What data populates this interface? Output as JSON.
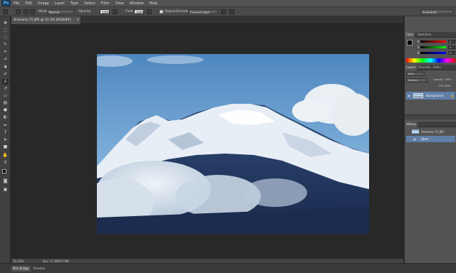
{
  "app": {
    "logo": "Ps"
  },
  "menu": [
    "File",
    "Edit",
    "Image",
    "Layer",
    "Type",
    "Select",
    "Filter",
    "View",
    "Window",
    "Help"
  ],
  "options": {
    "mode_label": "Mode:",
    "mode_value": "Normal",
    "opacity_label": "Opacity:",
    "opacity_value": "100%",
    "flow_label": "Flow:",
    "flow_value": "100%",
    "aligned_label": "Aligned",
    "sample_label": "Sample:",
    "sample_value": "Current Layer",
    "workspace_value": "Essentials"
  },
  "document": {
    "tab_title": "Antisana (7).JPG @ 33.3% (RGB/8#)",
    "close_glyph": "×"
  },
  "panels": {
    "color_tabs": [
      "Color",
      "Swatches"
    ],
    "color_channels": [
      {
        "label": "R",
        "value": "0"
      },
      {
        "label": "G",
        "value": "0"
      },
      {
        "label": "B",
        "value": "0"
      }
    ],
    "layers_tabs": [
      "Layers",
      "Channels",
      "Paths"
    ],
    "layers_kind": "Kind",
    "layers_blend": "Normal",
    "layers_opacity": "Opacity: 100%",
    "layers_fill": "Fill: 100%",
    "layer_name": "Background",
    "history_tabs": [
      "History"
    ],
    "history_items": [
      "Antisana (7).JPG",
      "Open"
    ]
  },
  "status": {
    "zoom": "33.33%",
    "doc_info": "Doc: 17.9M/17.9M"
  },
  "bottom_tabs": [
    "Mini Bridge",
    "Timeline"
  ],
  "colors": {
    "panel_bg": "#535353",
    "app_bg": "#262626",
    "selection": "#5f7fa7",
    "accent": "#5fb6f0"
  }
}
